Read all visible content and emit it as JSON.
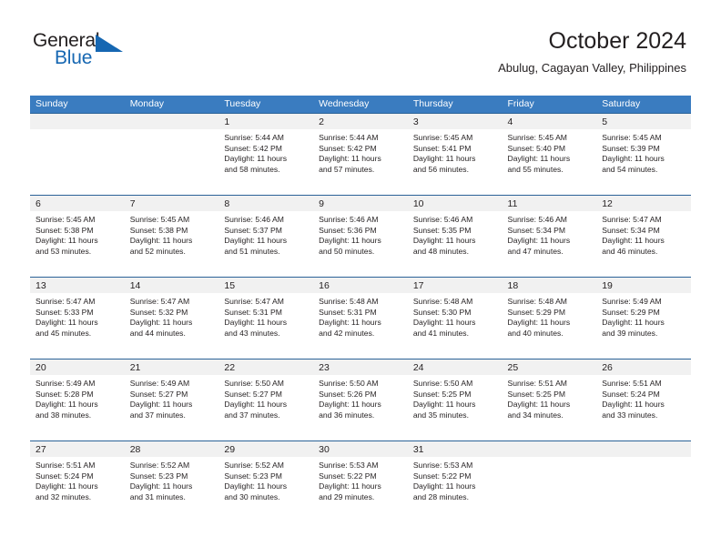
{
  "brand": {
    "name_top": "General",
    "name_bottom": "Blue",
    "triangle_icon": "triangle-icon",
    "color_blue": "#1667b2",
    "color_dark": "#231f20"
  },
  "header": {
    "title": "October 2024",
    "subtitle": "Abulug, Cagayan Valley, Philippines"
  },
  "theme": {
    "header_bg": "#3a7cc0",
    "header_text": "#ffffff",
    "date_band_bg": "#f1f1f1",
    "week_rule": "#2b6298",
    "cell_bg": "#ffffff",
    "body_text": "#231f20"
  },
  "weekdays": [
    "Sunday",
    "Monday",
    "Tuesday",
    "Wednesday",
    "Thursday",
    "Friday",
    "Saturday"
  ],
  "weeks": [
    [
      {
        "day": "",
        "sunrise": "",
        "sunset": "",
        "daylight_a": "",
        "daylight_b": ""
      },
      {
        "day": "",
        "sunrise": "",
        "sunset": "",
        "daylight_a": "",
        "daylight_b": ""
      },
      {
        "day": "1",
        "sunrise": "Sunrise: 5:44 AM",
        "sunset": "Sunset: 5:42 PM",
        "daylight_a": "Daylight: 11 hours",
        "daylight_b": "and 58 minutes."
      },
      {
        "day": "2",
        "sunrise": "Sunrise: 5:44 AM",
        "sunset": "Sunset: 5:42 PM",
        "daylight_a": "Daylight: 11 hours",
        "daylight_b": "and 57 minutes."
      },
      {
        "day": "3",
        "sunrise": "Sunrise: 5:45 AM",
        "sunset": "Sunset: 5:41 PM",
        "daylight_a": "Daylight: 11 hours",
        "daylight_b": "and 56 minutes."
      },
      {
        "day": "4",
        "sunrise": "Sunrise: 5:45 AM",
        "sunset": "Sunset: 5:40 PM",
        "daylight_a": "Daylight: 11 hours",
        "daylight_b": "and 55 minutes."
      },
      {
        "day": "5",
        "sunrise": "Sunrise: 5:45 AM",
        "sunset": "Sunset: 5:39 PM",
        "daylight_a": "Daylight: 11 hours",
        "daylight_b": "and 54 minutes."
      }
    ],
    [
      {
        "day": "6",
        "sunrise": "Sunrise: 5:45 AM",
        "sunset": "Sunset: 5:38 PM",
        "daylight_a": "Daylight: 11 hours",
        "daylight_b": "and 53 minutes."
      },
      {
        "day": "7",
        "sunrise": "Sunrise: 5:45 AM",
        "sunset": "Sunset: 5:38 PM",
        "daylight_a": "Daylight: 11 hours",
        "daylight_b": "and 52 minutes."
      },
      {
        "day": "8",
        "sunrise": "Sunrise: 5:46 AM",
        "sunset": "Sunset: 5:37 PM",
        "daylight_a": "Daylight: 11 hours",
        "daylight_b": "and 51 minutes."
      },
      {
        "day": "9",
        "sunrise": "Sunrise: 5:46 AM",
        "sunset": "Sunset: 5:36 PM",
        "daylight_a": "Daylight: 11 hours",
        "daylight_b": "and 50 minutes."
      },
      {
        "day": "10",
        "sunrise": "Sunrise: 5:46 AM",
        "sunset": "Sunset: 5:35 PM",
        "daylight_a": "Daylight: 11 hours",
        "daylight_b": "and 48 minutes."
      },
      {
        "day": "11",
        "sunrise": "Sunrise: 5:46 AM",
        "sunset": "Sunset: 5:34 PM",
        "daylight_a": "Daylight: 11 hours",
        "daylight_b": "and 47 minutes."
      },
      {
        "day": "12",
        "sunrise": "Sunrise: 5:47 AM",
        "sunset": "Sunset: 5:34 PM",
        "daylight_a": "Daylight: 11 hours",
        "daylight_b": "and 46 minutes."
      }
    ],
    [
      {
        "day": "13",
        "sunrise": "Sunrise: 5:47 AM",
        "sunset": "Sunset: 5:33 PM",
        "daylight_a": "Daylight: 11 hours",
        "daylight_b": "and 45 minutes."
      },
      {
        "day": "14",
        "sunrise": "Sunrise: 5:47 AM",
        "sunset": "Sunset: 5:32 PM",
        "daylight_a": "Daylight: 11 hours",
        "daylight_b": "and 44 minutes."
      },
      {
        "day": "15",
        "sunrise": "Sunrise: 5:47 AM",
        "sunset": "Sunset: 5:31 PM",
        "daylight_a": "Daylight: 11 hours",
        "daylight_b": "and 43 minutes."
      },
      {
        "day": "16",
        "sunrise": "Sunrise: 5:48 AM",
        "sunset": "Sunset: 5:31 PM",
        "daylight_a": "Daylight: 11 hours",
        "daylight_b": "and 42 minutes."
      },
      {
        "day": "17",
        "sunrise": "Sunrise: 5:48 AM",
        "sunset": "Sunset: 5:30 PM",
        "daylight_a": "Daylight: 11 hours",
        "daylight_b": "and 41 minutes."
      },
      {
        "day": "18",
        "sunrise": "Sunrise: 5:48 AM",
        "sunset": "Sunset: 5:29 PM",
        "daylight_a": "Daylight: 11 hours",
        "daylight_b": "and 40 minutes."
      },
      {
        "day": "19",
        "sunrise": "Sunrise: 5:49 AM",
        "sunset": "Sunset: 5:29 PM",
        "daylight_a": "Daylight: 11 hours",
        "daylight_b": "and 39 minutes."
      }
    ],
    [
      {
        "day": "20",
        "sunrise": "Sunrise: 5:49 AM",
        "sunset": "Sunset: 5:28 PM",
        "daylight_a": "Daylight: 11 hours",
        "daylight_b": "and 38 minutes."
      },
      {
        "day": "21",
        "sunrise": "Sunrise: 5:49 AM",
        "sunset": "Sunset: 5:27 PM",
        "daylight_a": "Daylight: 11 hours",
        "daylight_b": "and 37 minutes."
      },
      {
        "day": "22",
        "sunrise": "Sunrise: 5:50 AM",
        "sunset": "Sunset: 5:27 PM",
        "daylight_a": "Daylight: 11 hours",
        "daylight_b": "and 37 minutes."
      },
      {
        "day": "23",
        "sunrise": "Sunrise: 5:50 AM",
        "sunset": "Sunset: 5:26 PM",
        "daylight_a": "Daylight: 11 hours",
        "daylight_b": "and 36 minutes."
      },
      {
        "day": "24",
        "sunrise": "Sunrise: 5:50 AM",
        "sunset": "Sunset: 5:25 PM",
        "daylight_a": "Daylight: 11 hours",
        "daylight_b": "and 35 minutes."
      },
      {
        "day": "25",
        "sunrise": "Sunrise: 5:51 AM",
        "sunset": "Sunset: 5:25 PM",
        "daylight_a": "Daylight: 11 hours",
        "daylight_b": "and 34 minutes."
      },
      {
        "day": "26",
        "sunrise": "Sunrise: 5:51 AM",
        "sunset": "Sunset: 5:24 PM",
        "daylight_a": "Daylight: 11 hours",
        "daylight_b": "and 33 minutes."
      }
    ],
    [
      {
        "day": "27",
        "sunrise": "Sunrise: 5:51 AM",
        "sunset": "Sunset: 5:24 PM",
        "daylight_a": "Daylight: 11 hours",
        "daylight_b": "and 32 minutes."
      },
      {
        "day": "28",
        "sunrise": "Sunrise: 5:52 AM",
        "sunset": "Sunset: 5:23 PM",
        "daylight_a": "Daylight: 11 hours",
        "daylight_b": "and 31 minutes."
      },
      {
        "day": "29",
        "sunrise": "Sunrise: 5:52 AM",
        "sunset": "Sunset: 5:23 PM",
        "daylight_a": "Daylight: 11 hours",
        "daylight_b": "and 30 minutes."
      },
      {
        "day": "30",
        "sunrise": "Sunrise: 5:53 AM",
        "sunset": "Sunset: 5:22 PM",
        "daylight_a": "Daylight: 11 hours",
        "daylight_b": "and 29 minutes."
      },
      {
        "day": "31",
        "sunrise": "Sunrise: 5:53 AM",
        "sunset": "Sunset: 5:22 PM",
        "daylight_a": "Daylight: 11 hours",
        "daylight_b": "and 28 minutes."
      },
      {
        "day": "",
        "sunrise": "",
        "sunset": "",
        "daylight_a": "",
        "daylight_b": ""
      },
      {
        "day": "",
        "sunrise": "",
        "sunset": "",
        "daylight_a": "",
        "daylight_b": ""
      }
    ]
  ]
}
